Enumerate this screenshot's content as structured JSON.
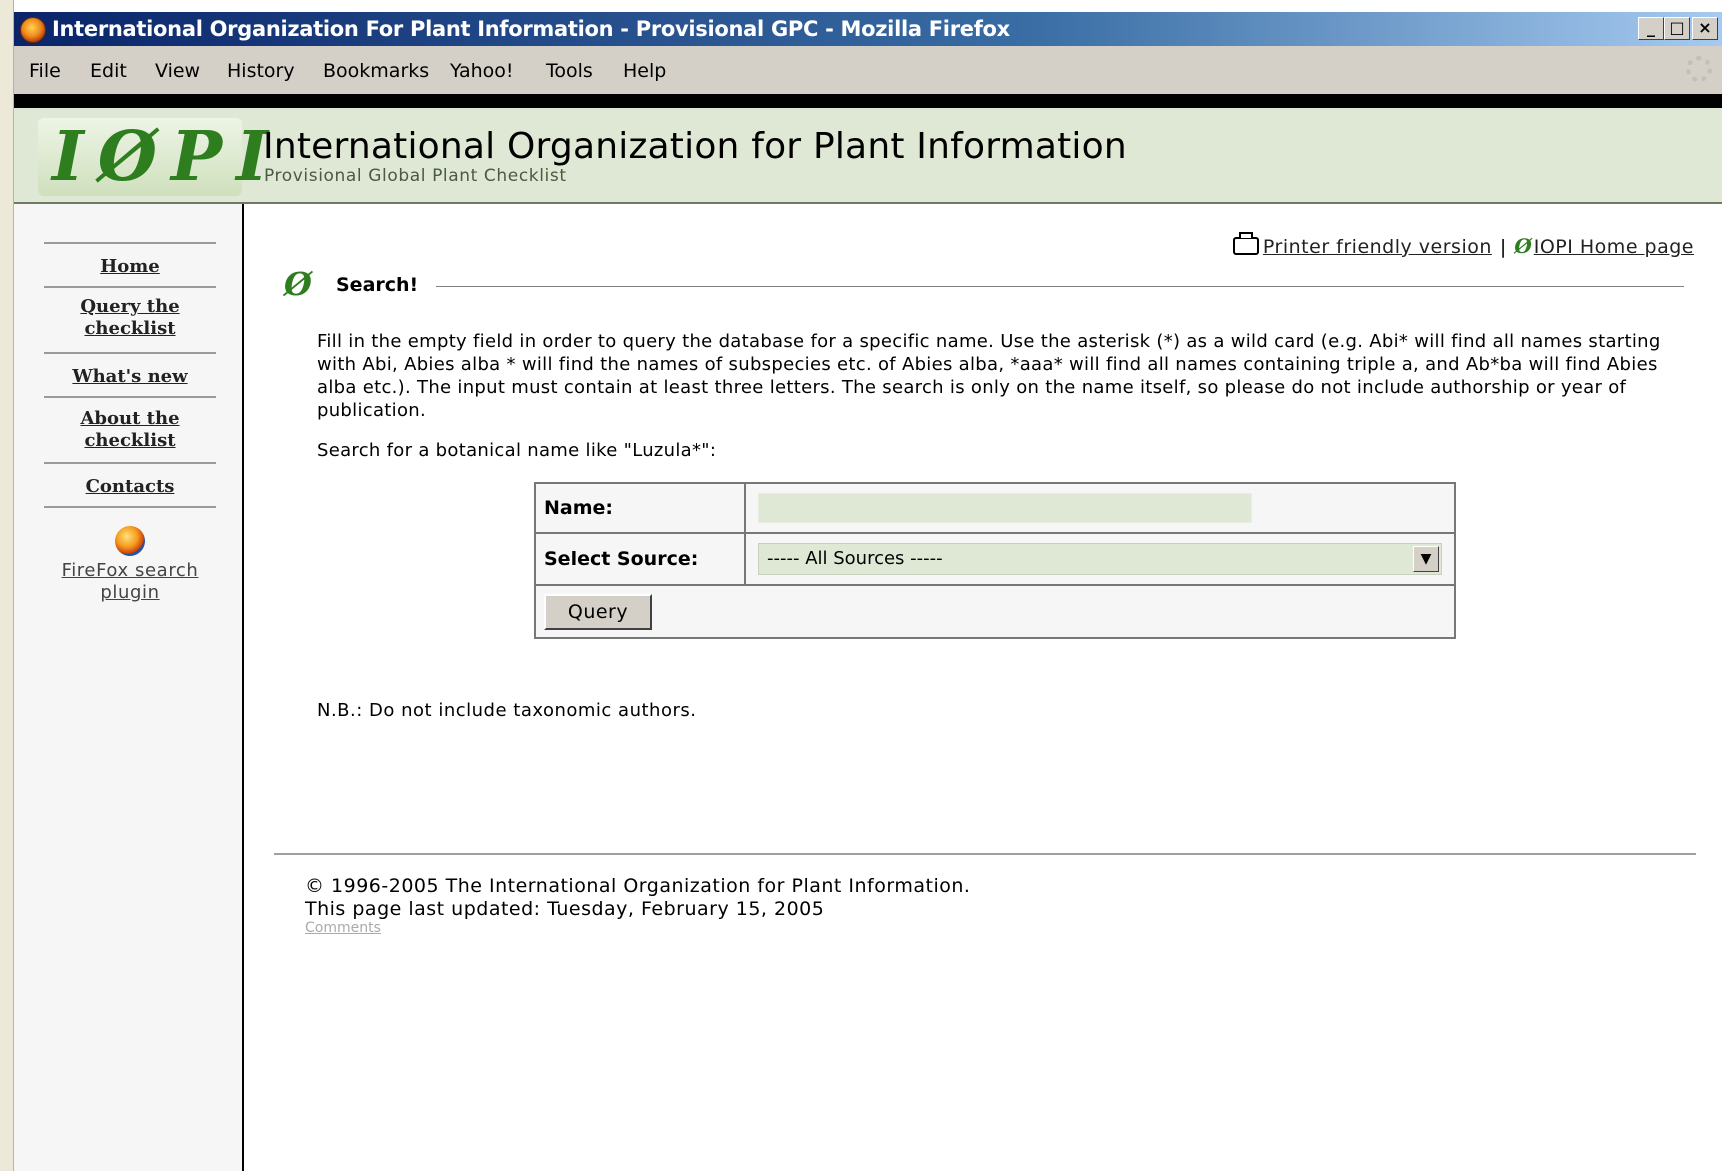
{
  "window": {
    "title": "International Organization For Plant Information - Provisional GPC - Mozilla Firefox",
    "minimize": "_",
    "maximize": "□",
    "close": "×"
  },
  "menubar": {
    "items": [
      "File",
      "Edit",
      "View",
      "History",
      "Bookmarks",
      "Yahoo!",
      "Tools",
      "Help"
    ]
  },
  "header": {
    "logo_text": "IØPI",
    "title": "International Organization for Plant Information",
    "subtitle": "Provisional Global Plant Checklist"
  },
  "sidebar": {
    "nav": [
      {
        "label": "Home"
      },
      {
        "label": "Query the checklist"
      },
      {
        "label": "What's new"
      },
      {
        "label": "About the checklist"
      },
      {
        "label": "Contacts"
      }
    ],
    "plugin_label": "FireFox search plugin"
  },
  "toplinks": {
    "printer": "Printer friendly version",
    "separator": "|",
    "home": "IOPI Home page"
  },
  "section": {
    "title": "Search!"
  },
  "instructions": "Fill in the empty field in order to query the database for a specific name. Use the asterisk (*) as a wild card (e.g. Abi* will find all names starting with Abi, Abies alba * will find the names of subspecies etc. of Abies alba, *aaa* will find all names containing triple a, and Ab*ba will find Abies alba etc.). The input must contain at least three letters. The search is only on the name itself, so please do not include authorship or year of publication.",
  "prompt": "Search for a botanical name like \"Luzula*\":",
  "form": {
    "name_label": "Name:",
    "name_value": "",
    "source_label": "Select Source:",
    "source_selected": "----- All Sources -----",
    "submit_label": "Query"
  },
  "note": "N.B.: Do not include taxonomic authors.",
  "footer": {
    "copyright": "© 1996-2005 The International Organization for Plant Information.",
    "updated": "This page last updated: Tuesday, February 15, 2005",
    "comments": "Comments"
  },
  "colors": {
    "header_bg": "#dfe8d4",
    "input_bg": "#dfe8d4",
    "logo_green": "#2e7d1e",
    "titlebar": "#0a246a"
  }
}
